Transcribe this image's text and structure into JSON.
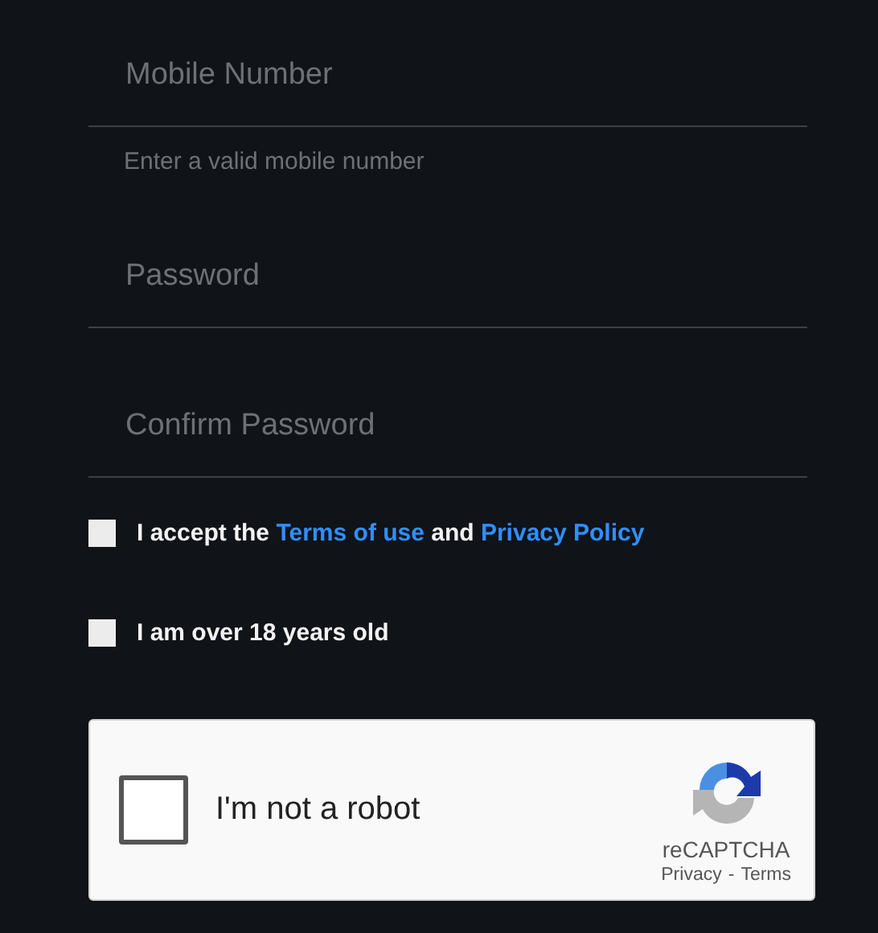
{
  "fields": [
    {
      "placeholder": "Mobile Number",
      "hint": "Enter a valid mobile number"
    },
    {
      "placeholder": "Password"
    },
    {
      "placeholder": "Confirm Password"
    }
  ],
  "agreements": [
    {
      "checked": false,
      "parts": [
        {
          "kind": "text",
          "text": "I accept the"
        },
        {
          "kind": "link",
          "text": "Terms of use"
        },
        {
          "kind": "text",
          "text": "and"
        },
        {
          "kind": "link",
          "text": "Privacy Policy"
        }
      ]
    },
    {
      "checked": false,
      "parts": [
        {
          "kind": "text",
          "text": "I am over 18 years old"
        }
      ]
    }
  ],
  "captcha": {
    "checked": false,
    "label": "I'm not a robot",
    "brand": "reCAPTCHA",
    "privacy": "Privacy",
    "separator": "-",
    "terms": "Terms"
  }
}
